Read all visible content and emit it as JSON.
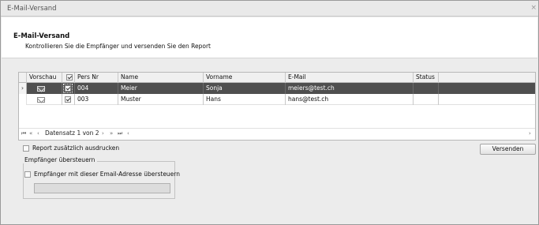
{
  "window": {
    "title": "E-Mail-Versand",
    "close_glyph": "×"
  },
  "header": {
    "title": "E-Mail-Versand",
    "subtitle": "Kontrollieren Sie die Empfänger und versenden Sie den Report"
  },
  "grid": {
    "columns": [
      "Vorschau",
      "",
      "Pers Nr",
      "Name",
      "Vorname",
      "E-Mail",
      "Status"
    ],
    "rows": [
      {
        "pers_nr": "004",
        "name": "Meier",
        "vorname": "Sonja",
        "email": "meiers@test.ch",
        "status": "",
        "checked": true,
        "selected": true
      },
      {
        "pers_nr": "003",
        "name": "Muster",
        "vorname": "Hans",
        "email": "hans@test.ch",
        "status": "",
        "checked": true,
        "selected": false
      }
    ],
    "navigator": {
      "record_text": "Datensatz 1 von 2"
    }
  },
  "options": {
    "print_report_label": "Report zusätzlich ausdrucken",
    "send_button": "Versenden",
    "override_group_label": "Empfänger übersteuern",
    "override_checkbox_label": "Empfänger mit dieser Email-Adresse übersteuern",
    "override_value": ""
  },
  "icons": {
    "row_indicator": "›",
    "preview": "envelope-icon"
  }
}
